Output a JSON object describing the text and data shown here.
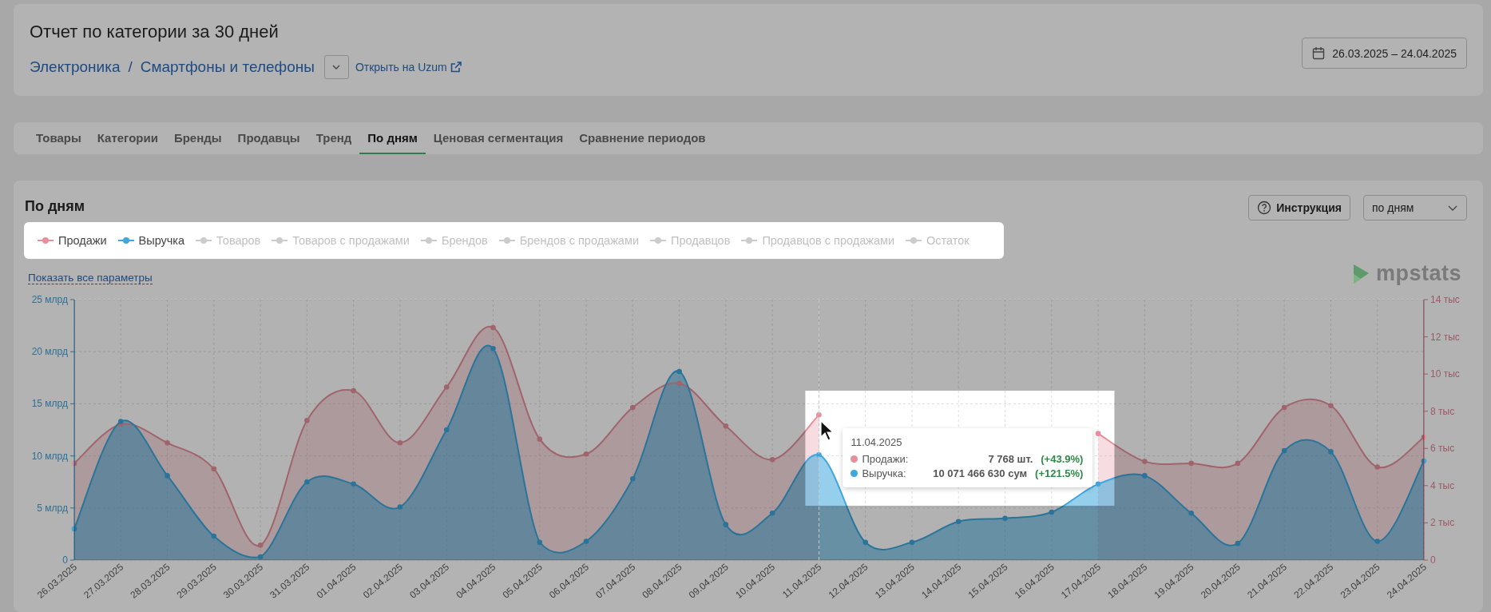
{
  "header": {
    "title": "Отчет по категории за 30 дней",
    "breadcrumbs": [
      "Электроника",
      "Смартфоны и телефоны"
    ],
    "breadcrumb_separator": "/",
    "open_link": "Открыть на Uzum",
    "date_range": "26.03.2025 – 24.04.2025"
  },
  "tabs": [
    {
      "label": "Товары",
      "selected": false
    },
    {
      "label": "Категории",
      "selected": false
    },
    {
      "label": "Бренды",
      "selected": false
    },
    {
      "label": "Продавцы",
      "selected": false
    },
    {
      "label": "Тренд",
      "selected": false
    },
    {
      "label": "По дням",
      "selected": true
    },
    {
      "label": "Ценовая сегментация",
      "selected": false
    },
    {
      "label": "Сравнение периодов",
      "selected": false
    }
  ],
  "section": {
    "title": "По дням",
    "help_button": "Инструкция",
    "period_select": "по дням",
    "show_all_link": "Показать все параметры",
    "logo_text": "mpstats"
  },
  "series_legend": [
    {
      "selected": true
    },
    {
      "selected": true
    }
  ],
  "legend": [
    {
      "label": "Товаров",
      "selected": false,
      "color": "#cccccc"
    },
    {
      "label": "Товаров с продажами",
      "selected": false,
      "color": "#cccccc"
    },
    {
      "label": "Брендов",
      "selected": false,
      "color": "#cccccc"
    },
    {
      "label": "Брендов с продажами",
      "selected": false,
      "color": "#cccccc"
    },
    {
      "label": "Продавцов",
      "selected": false,
      "color": "#cccccc"
    },
    {
      "label": "Продавцов с продажами",
      "selected": false,
      "color": "#cccccc"
    },
    {
      "label": "Остаток",
      "selected": false,
      "color": "#cccccc"
    }
  ],
  "chart_data": {
    "type": "area",
    "categories": [
      "26.03.2025",
      "27.03.2025",
      "28.03.2025",
      "29.03.2025",
      "30.03.2025",
      "31.03.2025",
      "01.04.2025",
      "02.04.2025",
      "03.04.2025",
      "04.04.2025",
      "05.04.2025",
      "06.04.2025",
      "07.04.2025",
      "08.04.2025",
      "09.04.2025",
      "10.04.2025",
      "11.04.2025",
      "12.04.2025",
      "13.04.2025",
      "14.04.2025",
      "15.04.2025",
      "16.04.2025",
      "17.04.2025",
      "18.04.2025",
      "19.04.2025",
      "20.04.2025",
      "21.04.2025",
      "22.04.2025",
      "23.04.2025",
      "24.04.2025"
    ],
    "series": [
      {
        "name": "Продажи",
        "color": "#e5909c",
        "axis": "y2",
        "values": [
          5.2,
          7.3,
          6.3,
          4.9,
          0.8,
          7.5,
          9.1,
          6.3,
          9.3,
          12.5,
          6.5,
          5.7,
          8.2,
          9.5,
          7.2,
          5.4,
          7.8,
          null,
          null,
          null,
          null,
          null,
          6.8,
          5.3,
          5.2,
          5.2,
          8.2,
          8.3,
          5.0,
          6.6
        ]
      },
      {
        "name": "Выручка",
        "color": "#3ea7dc",
        "values": [
          3.0,
          13.3,
          8.1,
          2.3,
          0.3,
          7.5,
          7.3,
          5.1,
          12.5,
          20.3,
          1.7,
          1.8,
          7.8,
          18.1,
          3.4,
          4.5,
          10.1,
          1.7,
          1.7,
          3.7,
          4.0,
          4.6,
          7.3,
          8.1,
          4.5,
          1.6,
          10.5,
          10.4,
          1.8,
          9.5
        ]
      }
    ],
    "grid": true,
    "ylim": [
      0,
      25
    ],
    "yticks": [
      {
        "value": 0,
        "label": "0"
      },
      {
        "value": 5,
        "label": "5 млрд"
      },
      {
        "value": 10,
        "label": "10 млрд"
      },
      {
        "value": 15,
        "label": "15 млрд"
      },
      {
        "value": 20,
        "label": "20 млрд"
      },
      {
        "value": 25,
        "label": "25 млрд"
      }
    ],
    "y2lim": [
      0,
      14
    ],
    "y2ticks": [
      {
        "value": 0,
        "label": "0"
      },
      {
        "value": 2,
        "label": "2 тыс"
      },
      {
        "value": 4,
        "label": "4 тыс"
      },
      {
        "value": 6,
        "label": "6 тыс"
      },
      {
        "value": 8,
        "label": "8 тыс"
      },
      {
        "value": 10,
        "label": "10 тыс"
      },
      {
        "value": 12,
        "label": "12 тыс"
      },
      {
        "value": 14,
        "label": "14 тыс"
      }
    ]
  },
  "tooltip": {
    "date": "11.04.2025",
    "rows": [
      {
        "name": "Продажи:",
        "value": "7 768 шт.",
        "change": "(+43.9%)",
        "color": "#e5909c"
      },
      {
        "name": "Выручка:",
        "value": "10 071 466 630 сум",
        "change": "(+121.5%)",
        "color": "#3ea7dc"
      }
    ]
  }
}
